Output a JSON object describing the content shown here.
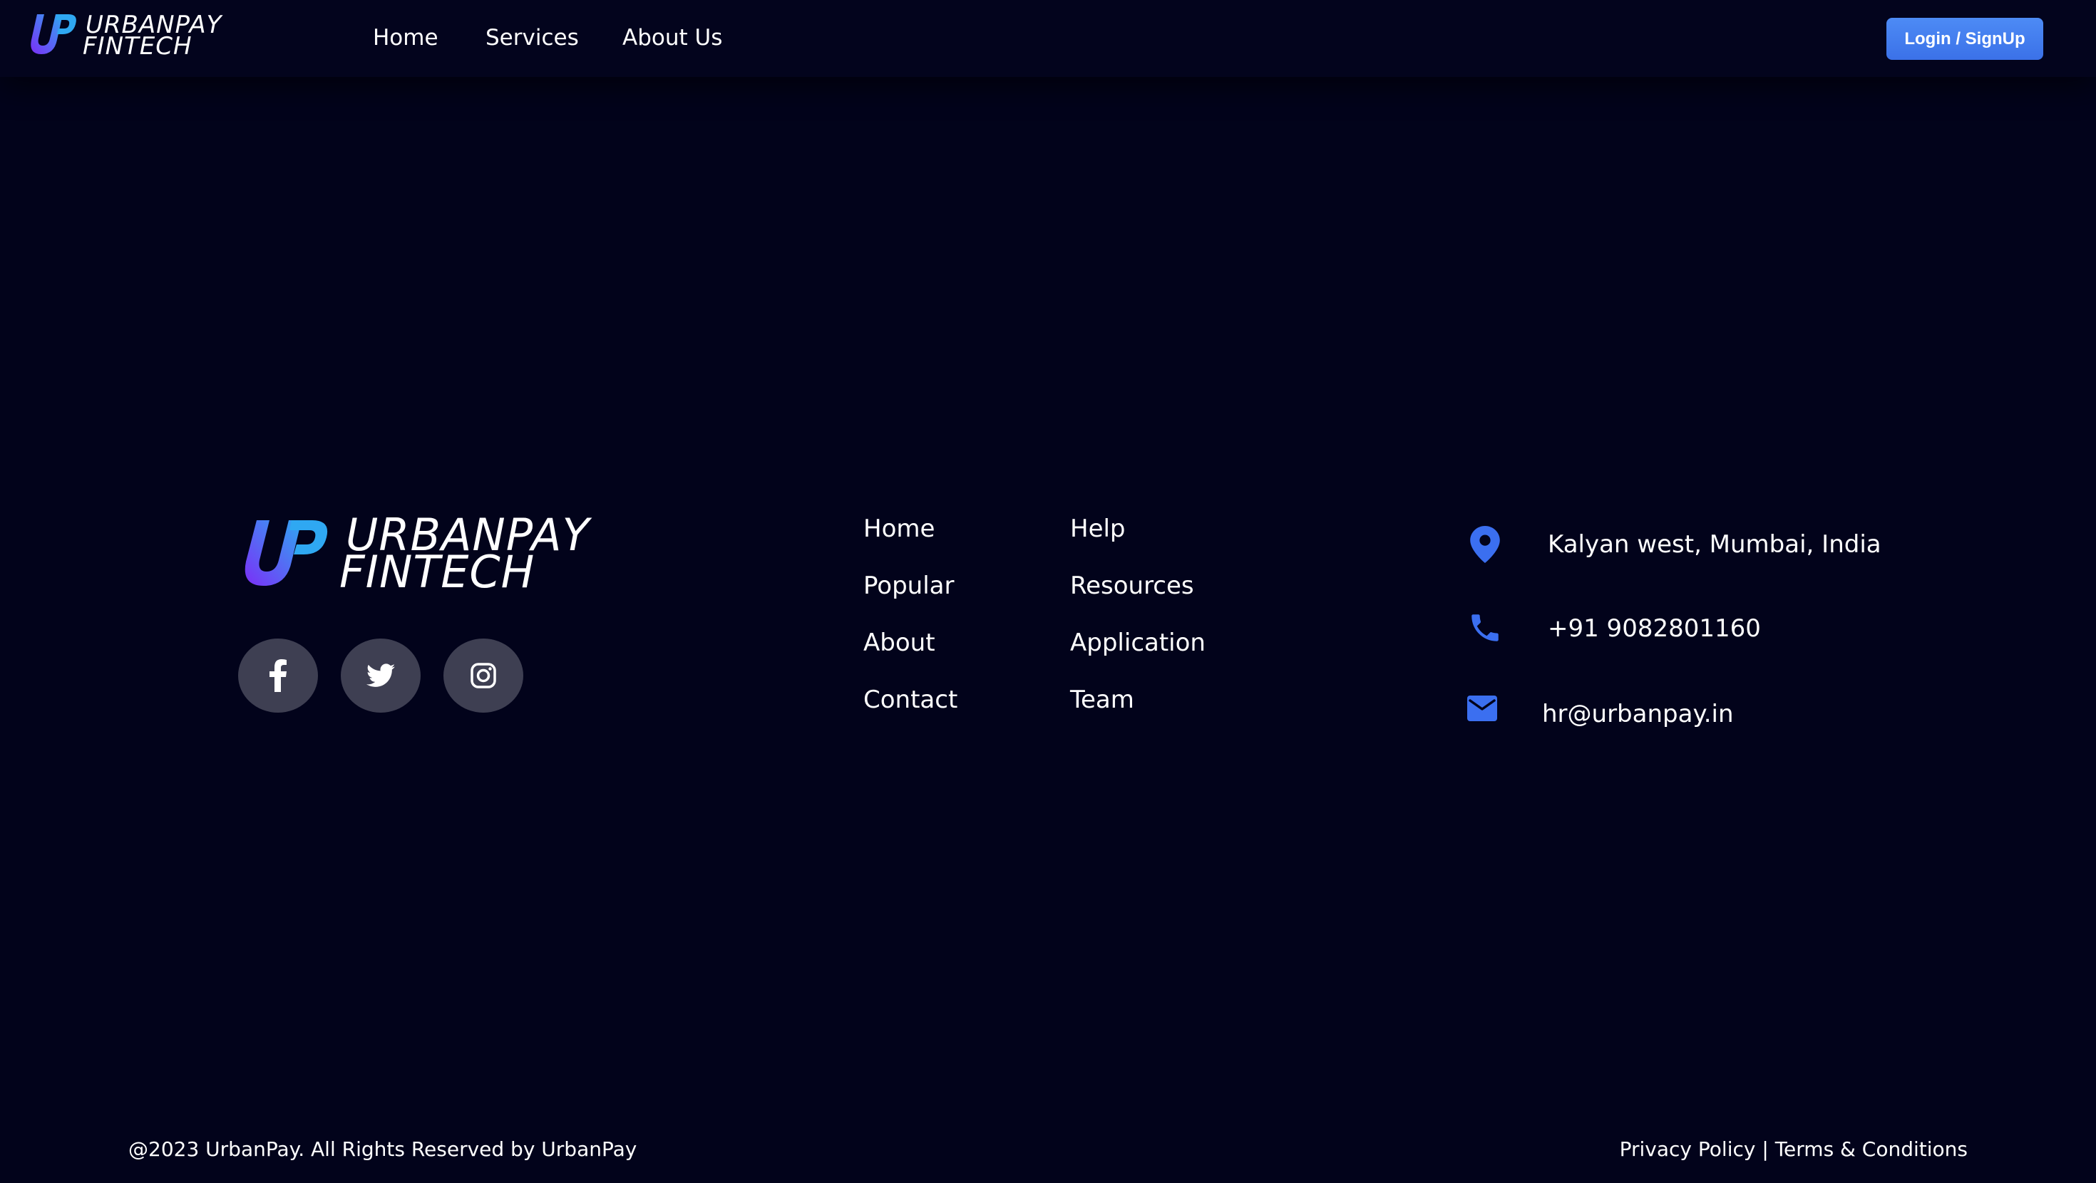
{
  "brand": {
    "line1": "URBANPAY",
    "line2": "FINTECH",
    "accent_start": "#7b2ff7",
    "accent_end": "#2fa8f2"
  },
  "header": {
    "nav": [
      "Home",
      "Services",
      "About Us"
    ],
    "login_label": "Login / SignUp"
  },
  "footer": {
    "social": [
      {
        "icon": "facebook-icon"
      },
      {
        "icon": "twitter-icon"
      },
      {
        "icon": "instagram-icon"
      }
    ],
    "links_col1": [
      "Home",
      "Popular",
      "About",
      "Contact"
    ],
    "links_col2": [
      "Help",
      "Resources",
      "Application",
      "Team"
    ],
    "contact": {
      "address": "Kalyan west, Mumbai, India",
      "phone": "+91 9082801160",
      "email": "hr@urbanpay.in",
      "icon_color": "#3b6ff0"
    },
    "copyright": "@2023 UrbanPay. All Rights Reserved by UrbanPay",
    "privacy": "Privacy Policy",
    "separator": "|",
    "terms": "Terms & Conditions"
  },
  "colors": {
    "background": "#02031b",
    "button": "#4a86f2",
    "social_bg": "#3e3f52"
  }
}
